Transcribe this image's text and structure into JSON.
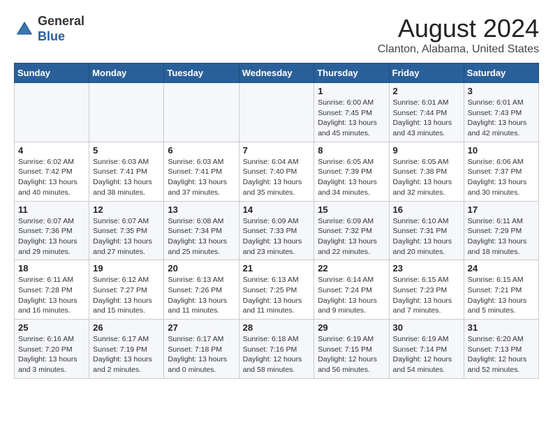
{
  "header": {
    "logo_general": "General",
    "logo_blue": "Blue",
    "month_year": "August 2024",
    "location": "Clanton, Alabama, United States"
  },
  "weekdays": [
    "Sunday",
    "Monday",
    "Tuesday",
    "Wednesday",
    "Thursday",
    "Friday",
    "Saturday"
  ],
  "weeks": [
    [
      {
        "day": "",
        "info": ""
      },
      {
        "day": "",
        "info": ""
      },
      {
        "day": "",
        "info": ""
      },
      {
        "day": "",
        "info": ""
      },
      {
        "day": "1",
        "info": "Sunrise: 6:00 AM\nSunset: 7:45 PM\nDaylight: 13 hours\nand 45 minutes."
      },
      {
        "day": "2",
        "info": "Sunrise: 6:01 AM\nSunset: 7:44 PM\nDaylight: 13 hours\nand 43 minutes."
      },
      {
        "day": "3",
        "info": "Sunrise: 6:01 AM\nSunset: 7:43 PM\nDaylight: 13 hours\nand 42 minutes."
      }
    ],
    [
      {
        "day": "4",
        "info": "Sunrise: 6:02 AM\nSunset: 7:42 PM\nDaylight: 13 hours\nand 40 minutes."
      },
      {
        "day": "5",
        "info": "Sunrise: 6:03 AM\nSunset: 7:41 PM\nDaylight: 13 hours\nand 38 minutes."
      },
      {
        "day": "6",
        "info": "Sunrise: 6:03 AM\nSunset: 7:41 PM\nDaylight: 13 hours\nand 37 minutes."
      },
      {
        "day": "7",
        "info": "Sunrise: 6:04 AM\nSunset: 7:40 PM\nDaylight: 13 hours\nand 35 minutes."
      },
      {
        "day": "8",
        "info": "Sunrise: 6:05 AM\nSunset: 7:39 PM\nDaylight: 13 hours\nand 34 minutes."
      },
      {
        "day": "9",
        "info": "Sunrise: 6:05 AM\nSunset: 7:38 PM\nDaylight: 13 hours\nand 32 minutes."
      },
      {
        "day": "10",
        "info": "Sunrise: 6:06 AM\nSunset: 7:37 PM\nDaylight: 13 hours\nand 30 minutes."
      }
    ],
    [
      {
        "day": "11",
        "info": "Sunrise: 6:07 AM\nSunset: 7:36 PM\nDaylight: 13 hours\nand 29 minutes."
      },
      {
        "day": "12",
        "info": "Sunrise: 6:07 AM\nSunset: 7:35 PM\nDaylight: 13 hours\nand 27 minutes."
      },
      {
        "day": "13",
        "info": "Sunrise: 6:08 AM\nSunset: 7:34 PM\nDaylight: 13 hours\nand 25 minutes."
      },
      {
        "day": "14",
        "info": "Sunrise: 6:09 AM\nSunset: 7:33 PM\nDaylight: 13 hours\nand 23 minutes."
      },
      {
        "day": "15",
        "info": "Sunrise: 6:09 AM\nSunset: 7:32 PM\nDaylight: 13 hours\nand 22 minutes."
      },
      {
        "day": "16",
        "info": "Sunrise: 6:10 AM\nSunset: 7:31 PM\nDaylight: 13 hours\nand 20 minutes."
      },
      {
        "day": "17",
        "info": "Sunrise: 6:11 AM\nSunset: 7:29 PM\nDaylight: 13 hours\nand 18 minutes."
      }
    ],
    [
      {
        "day": "18",
        "info": "Sunrise: 6:11 AM\nSunset: 7:28 PM\nDaylight: 13 hours\nand 16 minutes."
      },
      {
        "day": "19",
        "info": "Sunrise: 6:12 AM\nSunset: 7:27 PM\nDaylight: 13 hours\nand 15 minutes."
      },
      {
        "day": "20",
        "info": "Sunrise: 6:13 AM\nSunset: 7:26 PM\nDaylight: 13 hours\nand 11 minutes."
      },
      {
        "day": "21",
        "info": "Sunrise: 6:13 AM\nSunset: 7:25 PM\nDaylight: 13 hours\nand 11 minutes."
      },
      {
        "day": "22",
        "info": "Sunrise: 6:14 AM\nSunset: 7:24 PM\nDaylight: 13 hours\nand 9 minutes."
      },
      {
        "day": "23",
        "info": "Sunrise: 6:15 AM\nSunset: 7:23 PM\nDaylight: 13 hours\nand 7 minutes."
      },
      {
        "day": "24",
        "info": "Sunrise: 6:15 AM\nSunset: 7:21 PM\nDaylight: 13 hours\nand 5 minutes."
      }
    ],
    [
      {
        "day": "25",
        "info": "Sunrise: 6:16 AM\nSunset: 7:20 PM\nDaylight: 13 hours\nand 3 minutes."
      },
      {
        "day": "26",
        "info": "Sunrise: 6:17 AM\nSunset: 7:19 PM\nDaylight: 13 hours\nand 2 minutes."
      },
      {
        "day": "27",
        "info": "Sunrise: 6:17 AM\nSunset: 7:18 PM\nDaylight: 13 hours\nand 0 minutes."
      },
      {
        "day": "28",
        "info": "Sunrise: 6:18 AM\nSunset: 7:16 PM\nDaylight: 12 hours\nand 58 minutes."
      },
      {
        "day": "29",
        "info": "Sunrise: 6:19 AM\nSunset: 7:15 PM\nDaylight: 12 hours\nand 56 minutes."
      },
      {
        "day": "30",
        "info": "Sunrise: 6:19 AM\nSunset: 7:14 PM\nDaylight: 12 hours\nand 54 minutes."
      },
      {
        "day": "31",
        "info": "Sunrise: 6:20 AM\nSunset: 7:13 PM\nDaylight: 12 hours\nand 52 minutes."
      }
    ]
  ]
}
